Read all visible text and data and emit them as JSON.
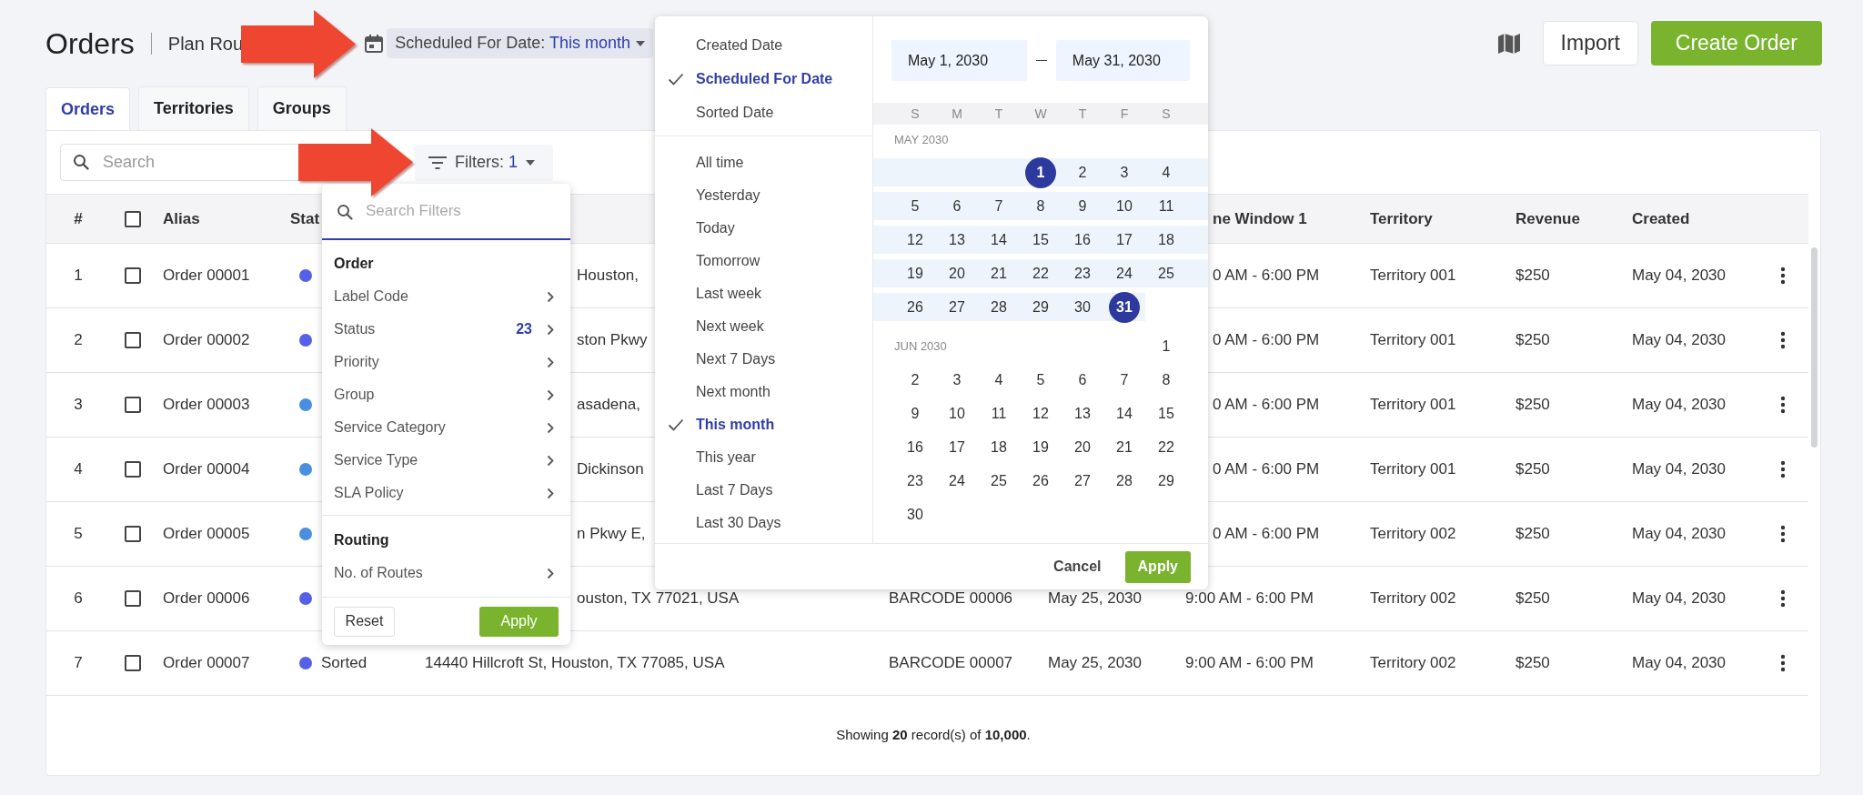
{
  "header": {
    "title": "Orders",
    "subtitle": "Plan Rou",
    "date_chip": {
      "label": "Scheduled For Date: ",
      "value": "This month"
    },
    "buttons": [
      {
        "label": "Import",
        "kind": "secondary"
      },
      {
        "label": "Create Order",
        "kind": "primary"
      }
    ]
  },
  "tabs": [
    {
      "label": "Orders",
      "selected": true
    },
    {
      "label": "Territories",
      "selected": false
    },
    {
      "label": "Groups",
      "selected": false
    }
  ],
  "search": {
    "placeholder": "Search"
  },
  "filters_chip": {
    "label": "Filters: ",
    "count": "1"
  },
  "table": {
    "header": {
      "number": "#",
      "checked": false,
      "alias": "Alias",
      "status": "Stat",
      "time_window": "ne Window 1",
      "territory": "Territory",
      "revenue": "Revenue",
      "created": "Created"
    },
    "rows": [
      {
        "number": "1",
        "checked": false,
        "alias": "Order 00001",
        "color": "#5560e8",
        "address": "Houston,",
        "time_window": "0 AM - 6:00 PM",
        "territory": "Territory 001",
        "revenue": "$250",
        "created": "May 04, 2030"
      },
      {
        "number": "2",
        "checked": false,
        "alias": "Order 00002",
        "color": "#5560e8",
        "address": "ston Pkwy",
        "time_window": "0 AM - 6:00 PM",
        "territory": "Territory 001",
        "revenue": "$250",
        "created": "May 04, 2030"
      },
      {
        "number": "3",
        "checked": false,
        "alias": "Order 00003",
        "color": "#4a8ee0",
        "address": "asadena,",
        "time_window": "0 AM - 6:00 PM",
        "territory": "Territory 001",
        "revenue": "$250",
        "created": "May 04, 2030"
      },
      {
        "number": "4",
        "checked": false,
        "alias": "Order 00004",
        "color": "#4a8ee0",
        "address": "Dickinson",
        "time_window": "0 AM - 6:00 PM",
        "territory": "Territory 001",
        "revenue": "$250",
        "created": "May 04, 2030"
      },
      {
        "number": "5",
        "checked": false,
        "alias": "Order 00005",
        "color": "#4a8ee0",
        "address": "n Pkwy E,",
        "time_window": "0 AM - 6:00 PM",
        "territory": "Territory 002",
        "revenue": "$250",
        "created": "May 04, 2030"
      },
      {
        "number": "6",
        "checked": false,
        "alias": "Order 00006",
        "color": "#5560e8",
        "address": "ouston, TX 77021, USA",
        "label_code": "BARCODE 00006",
        "scheduled": "May 25, 2030",
        "time_window": "9:00 AM - 6:00 PM",
        "territory": "Territory 002",
        "revenue": "$250",
        "created": "May 04, 2030"
      },
      {
        "number": "7",
        "checked": false,
        "alias": "Order 00007",
        "color": "#5560e8",
        "status": "Sorted",
        "address": "14440 Hillcroft St, Houston, TX 77085, USA",
        "label_code": "BARCODE 00007",
        "scheduled": "May 25, 2030",
        "time_window": "9:00 AM - 6:00 PM",
        "territory": "Territory 002",
        "revenue": "$250",
        "created": "May 04, 2030"
      }
    ]
  },
  "footer": "Showing **20** record(s) of **10,000**.",
  "filter_menu": {
    "placeholder": "Search Filters",
    "sections": [
      {
        "heading": "Order",
        "items": [
          {
            "label": "Label Code"
          },
          {
            "label": "Status",
            "count": "23"
          },
          {
            "label": "Priority"
          },
          {
            "label": "Group"
          },
          {
            "label": "Service Category"
          },
          {
            "label": "Service Type"
          },
          {
            "label": "SLA Policy"
          }
        ]
      },
      {
        "heading": "Routing",
        "items": [
          {
            "label": "No. of Routes"
          }
        ]
      }
    ],
    "buttons": [
      {
        "label": "Reset",
        "kind": "secondary"
      },
      {
        "label": "Apply",
        "kind": "primary"
      }
    ]
  },
  "date_menu": {
    "fields": [
      {
        "label": "Created Date",
        "selected": false
      },
      {
        "label": "Scheduled For Date",
        "selected": true
      },
      {
        "label": "Sorted Date",
        "selected": false
      }
    ],
    "presets": [
      {
        "label": "All time",
        "selected": false
      },
      {
        "label": "Yesterday",
        "selected": false
      },
      {
        "label": "Today",
        "selected": false
      },
      {
        "label": "Tomorrow",
        "selected": false
      },
      {
        "label": "Last week",
        "selected": false
      },
      {
        "label": "Next week",
        "selected": false
      },
      {
        "label": "Next 7 Days",
        "selected": false
      },
      {
        "label": "Next month",
        "selected": false
      },
      {
        "label": "This month",
        "selected": true
      },
      {
        "label": "This year",
        "selected": false
      },
      {
        "label": "Last 7 Days",
        "selected": false
      },
      {
        "label": "Last 30 Days",
        "selected": false
      }
    ],
    "range": {
      "start": "May 1, 2030",
      "end": "May 31, 2030"
    },
    "weekdays": [
      "S",
      "M",
      "T",
      "W",
      "T",
      "F",
      "S"
    ],
    "months": [
      {
        "label": "MAY 2030",
        "weeks": [
          {
            "in_range": true,
            "days": [
              {
                "label": "1",
                "selected": true
              },
              {
                "label": "2",
                "selected": false
              },
              {
                "label": "3",
                "selected": false
              },
              {
                "label": "4",
                "selected": false
              }
            ]
          },
          {
            "in_range": true,
            "days": [
              {
                "label": "5",
                "selected": false
              },
              {
                "label": "6",
                "selected": false
              },
              {
                "label": "7",
                "selected": false
              },
              {
                "label": "8",
                "selected": false
              },
              {
                "label": "9",
                "selected": false
              },
              {
                "label": "10",
                "selected": false
              },
              {
                "label": "11",
                "selected": false
              }
            ]
          },
          {
            "in_range": true,
            "days": [
              {
                "label": "12",
                "selected": false
              },
              {
                "label": "13",
                "selected": false
              },
              {
                "label": "14",
                "selected": false
              },
              {
                "label": "15",
                "selected": false
              },
              {
                "label": "16",
                "selected": false
              },
              {
                "label": "17",
                "selected": false
              },
              {
                "label": "18",
                "selected": false
              }
            ]
          },
          {
            "in_range": true,
            "days": [
              {
                "label": "19",
                "selected": false
              },
              {
                "label": "20",
                "selected": false
              },
              {
                "label": "21",
                "selected": false
              },
              {
                "label": "22",
                "selected": false
              },
              {
                "label": "23",
                "selected": false
              },
              {
                "label": "24",
                "selected": false
              },
              {
                "label": "25",
                "selected": false
              }
            ]
          },
          {
            "in_range": true,
            "days": [
              {
                "label": "26",
                "selected": false
              },
              {
                "label": "27",
                "selected": false
              },
              {
                "label": "28",
                "selected": false
              },
              {
                "label": "29",
                "selected": false
              },
              {
                "label": "30",
                "selected": false
              },
              {
                "label": "31",
                "selected": true
              }
            ]
          }
        ]
      },
      {
        "label": "JUN 2030",
        "weeks": [
          {
            "in_range": false,
            "days": [
              {
                "label": "1",
                "selected": false
              }
            ]
          },
          {
            "in_range": false,
            "days": [
              {
                "label": "2",
                "selected": false
              },
              {
                "label": "3",
                "selected": false
              },
              {
                "label": "4",
                "selected": false
              },
              {
                "label": "5",
                "selected": false
              },
              {
                "label": "6",
                "selected": false
              },
              {
                "label": "7",
                "selected": false
              },
              {
                "label": "8",
                "selected": false
              }
            ]
          },
          {
            "in_range": false,
            "days": [
              {
                "label": "9",
                "selected": false
              },
              {
                "label": "10",
                "selected": false
              },
              {
                "label": "11",
                "selected": false
              },
              {
                "label": "12",
                "selected": false
              },
              {
                "label": "13",
                "selected": false
              },
              {
                "label": "14",
                "selected": false
              },
              {
                "label": "15",
                "selected": false
              }
            ]
          },
          {
            "in_range": false,
            "days": [
              {
                "label": "16",
                "selected": false
              },
              {
                "label": "17",
                "selected": false
              },
              {
                "label": "18",
                "selected": false
              },
              {
                "label": "19",
                "selected": false
              },
              {
                "label": "20",
                "selected": false
              },
              {
                "label": "21",
                "selected": false
              },
              {
                "label": "22",
                "selected": false
              }
            ]
          },
          {
            "in_range": false,
            "days": [
              {
                "label": "23",
                "selected": false
              },
              {
                "label": "24",
                "selected": false
              },
              {
                "label": "25",
                "selected": false
              },
              {
                "label": "26",
                "selected": false
              },
              {
                "label": "27",
                "selected": false
              },
              {
                "label": "28",
                "selected": false
              },
              {
                "label": "29",
                "selected": false
              }
            ]
          },
          {
            "in_range": false,
            "days": [
              {
                "label": "30",
                "selected": false
              }
            ]
          }
        ]
      }
    ],
    "buttons": [
      {
        "label": "Cancel",
        "kind": "secondary"
      },
      {
        "label": "Apply",
        "kind": "primary"
      }
    ]
  }
}
